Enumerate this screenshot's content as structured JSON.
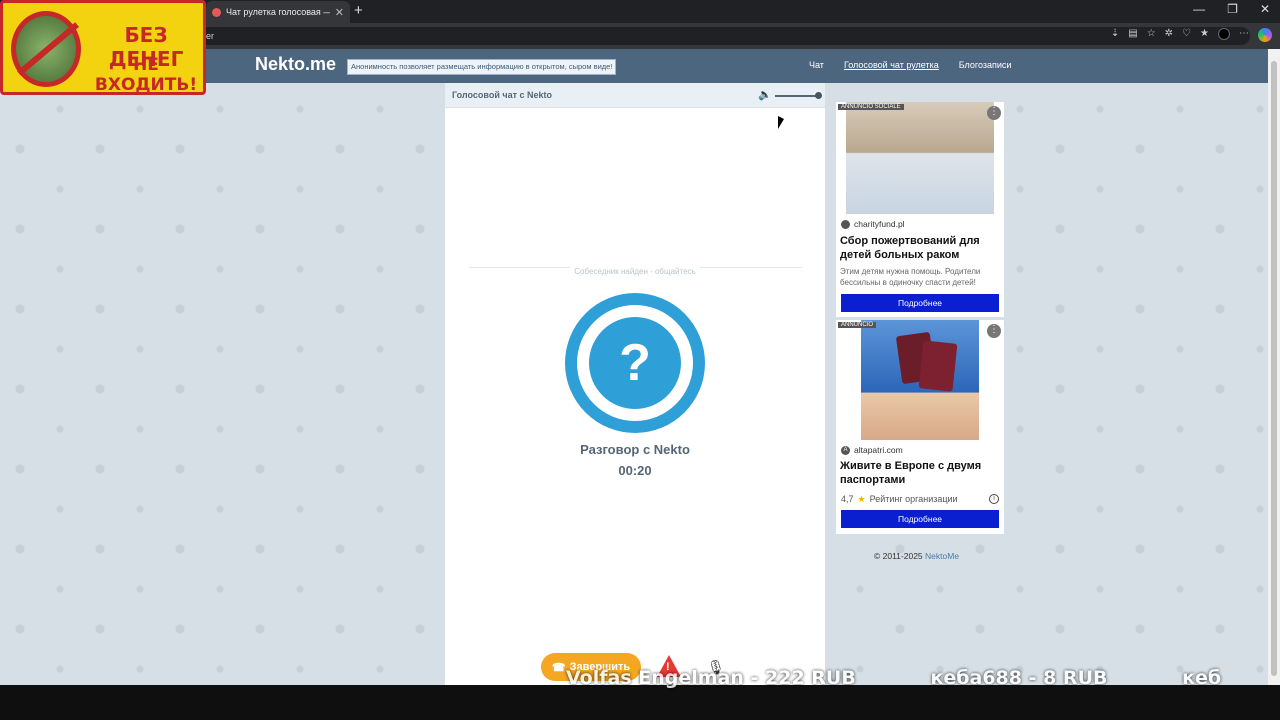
{
  "browser": {
    "tab_title": "Чат рулетка голосовая — N",
    "tab_close": "✕",
    "new_tab": "+",
    "url_fragment": "er",
    "window_controls": [
      "—",
      "❐",
      "✕"
    ],
    "toolbar_icons": [
      "download-icon",
      "reading-icon",
      "star-icon",
      "extensions-icon",
      "performance-icon",
      "favorites-icon",
      "profile-icon",
      "menu-icon",
      "copilot-icon"
    ]
  },
  "overlay_sign": {
    "line1": "БЕЗ ДЕНЕГ",
    "line2": "НЕ ВХОДИТЬ!"
  },
  "site": {
    "logo": "Nekto.me",
    "tagline": "Анонимность позволяет размещать информацию в открытом, сыром виде!",
    "nav": [
      "Чат",
      "Голосовой чат рулетка",
      "Блогозаписи"
    ]
  },
  "chat": {
    "header_title": "Голосовой чат с Nekto",
    "status_separator": "Собеседник найден - общайтесь",
    "avatar_symbol": "?",
    "talking_with": "Разговор с Nekto",
    "timer": "00:20",
    "end_button": "Завершить",
    "warn_symbol": "!",
    "volume_level": 1.0
  },
  "ads": [
    {
      "label": "ANNUNCIO SOCIALE",
      "domain": "charityfund.pl",
      "title": "Сбор пожертвований для детей больных раком",
      "description": "Этим детям нужна помощь. Родители бессильны в одиночку спасти детей!",
      "button": "Подробнее"
    },
    {
      "label": "ANNUNCIO",
      "domain": "altapatri.com",
      "title": "Живите в Европе с двумя паспортами",
      "rating_value": "4,7",
      "rating_text": "Рейтинг организации",
      "button": "Подробнее"
    }
  ],
  "footer": {
    "copyright": "© 2011-2025",
    "link": "NektoMe"
  },
  "ticker": [
    "Volfas Engelman - 222 RUB",
    "кеба688 - 8 RUB",
    "кеб"
  ]
}
